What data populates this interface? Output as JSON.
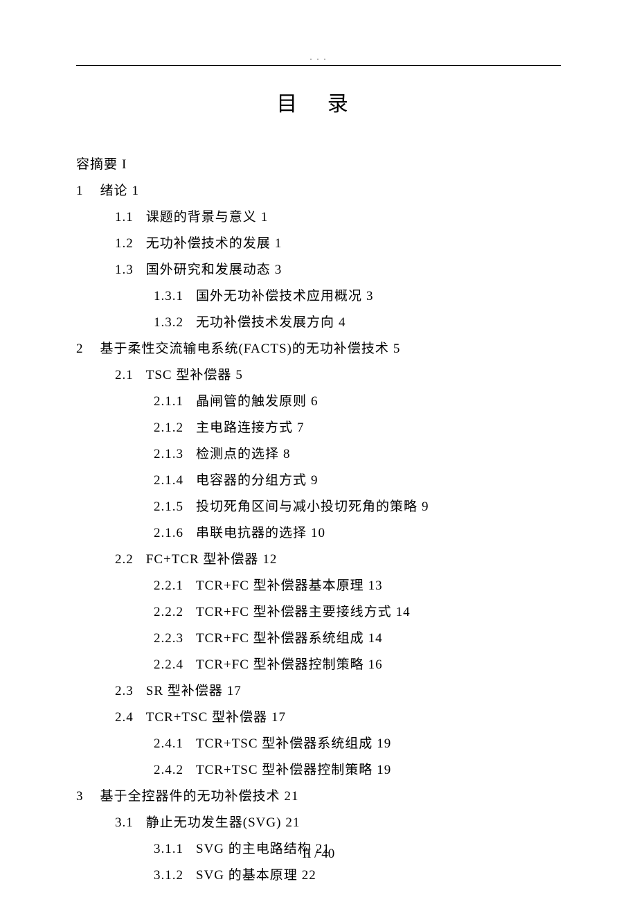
{
  "header_dots": ". .    .",
  "title": "目 录",
  "footer": "II / 40",
  "toc": [
    {
      "level": 0,
      "num": "",
      "label": "容摘要",
      "page": "I"
    },
    {
      "level": 0,
      "num": "1",
      "label": "绪论",
      "page": "1"
    },
    {
      "level": 1,
      "num": "1.1",
      "label": "课题的背景与意义",
      "page": "1"
    },
    {
      "level": 1,
      "num": "1.2",
      "label": "无功补偿技术的发展",
      "page": "1"
    },
    {
      "level": 1,
      "num": "1.3",
      "label": "国外研究和发展动态",
      "page": "3"
    },
    {
      "level": 2,
      "num": "1.3.1",
      "label": "国外无功补偿技术应用概况",
      "page": "3"
    },
    {
      "level": 2,
      "num": "1.3.2",
      "label": "无功补偿技术发展方向",
      "page": "4"
    },
    {
      "level": 0,
      "num": "2",
      "label": "基于柔性交流输电系统(FACTS)的无功补偿技术",
      "page": "5"
    },
    {
      "level": 1,
      "num": "2.1",
      "label": "TSC 型补偿器",
      "page": "5"
    },
    {
      "level": 2,
      "num": "2.1.1",
      "label": "晶闸管的触发原则",
      "page": "6"
    },
    {
      "level": 2,
      "num": "2.1.2",
      "label": "主电路连接方式",
      "page": "7"
    },
    {
      "level": 2,
      "num": "2.1.3",
      "label": "检测点的选择",
      "page": "8"
    },
    {
      "level": 2,
      "num": "2.1.4",
      "label": "电容器的分组方式",
      "page": "9"
    },
    {
      "level": 2,
      "num": "2.1.5",
      "label": "投切死角区间与减小投切死角的策略",
      "page": "9"
    },
    {
      "level": 2,
      "num": "2.1.6",
      "label": "串联电抗器的选择",
      "page": "10"
    },
    {
      "level": 1,
      "num": "2.2",
      "label": "FC+TCR 型补偿器",
      "page": "12"
    },
    {
      "level": 2,
      "num": "2.2.1",
      "label": "TCR+FC 型补偿器基本原理",
      "page": "13"
    },
    {
      "level": 2,
      "num": "2.2.2",
      "label": "TCR+FC 型补偿器主要接线方式",
      "page": "14"
    },
    {
      "level": 2,
      "num": "2.2.3",
      "label": "TCR+FC 型补偿器系统组成",
      "page": "14"
    },
    {
      "level": 2,
      "num": "2.2.4",
      "label": "TCR+FC 型补偿器控制策略",
      "page": "16"
    },
    {
      "level": 1,
      "num": "2.3",
      "label": "SR 型补偿器",
      "page": "17"
    },
    {
      "level": 1,
      "num": "2.4",
      "label": "TCR+TSC 型补偿器",
      "page": "17"
    },
    {
      "level": 2,
      "num": "2.4.1",
      "label": "TCR+TSC 型补偿器系统组成",
      "page": "19"
    },
    {
      "level": 2,
      "num": "2.4.2",
      "label": "TCR+TSC 型补偿器控制策略",
      "page": "19"
    },
    {
      "level": 0,
      "num": "3",
      "label": "基于全控器件的无功补偿技术",
      "page": "21"
    },
    {
      "level": 1,
      "num": "3.1",
      "label": "静止无功发生器(SVG)",
      "page": "21"
    },
    {
      "level": 2,
      "num": "3.1.1",
      "label": "SVG 的主电路结构",
      "page": "21"
    },
    {
      "level": 2,
      "num": "3.1.2",
      "label": "SVG 的基本原理",
      "page": "22"
    }
  ]
}
